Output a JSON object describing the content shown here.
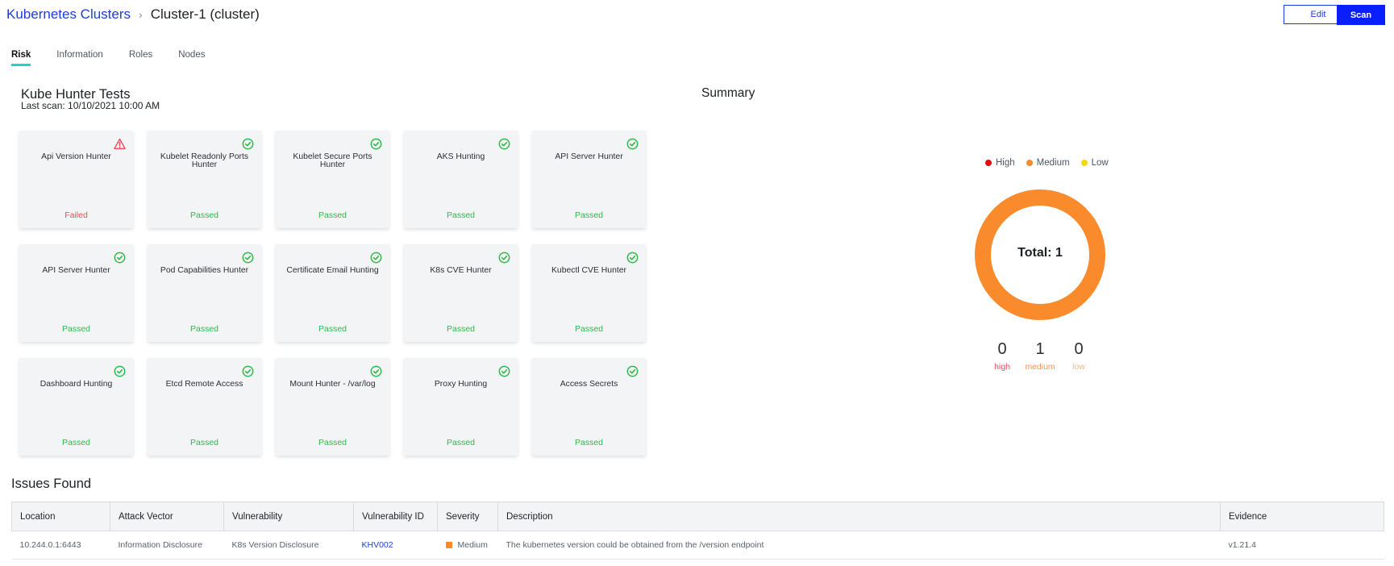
{
  "breadcrumb": {
    "parent": "Kubernetes Clusters",
    "separator": "›",
    "current": "Cluster-1 (cluster)"
  },
  "header_actions": {
    "edit_label": "Edit",
    "scan_label": "Scan"
  },
  "tabs": [
    {
      "label": "Risk",
      "active": true
    },
    {
      "label": "Information",
      "active": false
    },
    {
      "label": "Roles",
      "active": false
    },
    {
      "label": "Nodes",
      "active": false
    }
  ],
  "tests": {
    "title": "Kube Hunter Tests",
    "last_scan": "Last scan: 10/10/2021 10:00 AM",
    "items": [
      {
        "name": "Api Version Hunter",
        "status": "Failed",
        "icon": "warning-icon"
      },
      {
        "name": "Kubelet Readonly Ports Hunter",
        "status": "Passed",
        "icon": "check-circle-icon"
      },
      {
        "name": "Kubelet Secure Ports Hunter",
        "status": "Passed",
        "icon": "check-circle-icon"
      },
      {
        "name": "AKS Hunting",
        "status": "Passed",
        "icon": "check-circle-icon"
      },
      {
        "name": "API Server Hunter",
        "status": "Passed",
        "icon": "check-circle-icon"
      },
      {
        "name": "API Server Hunter",
        "status": "Passed",
        "icon": "check-circle-icon"
      },
      {
        "name": "Pod Capabilities Hunter",
        "status": "Passed",
        "icon": "check-circle-icon"
      },
      {
        "name": "Certificate Email Hunting",
        "status": "Passed",
        "icon": "check-circle-icon"
      },
      {
        "name": "K8s CVE Hunter",
        "status": "Passed",
        "icon": "check-circle-icon"
      },
      {
        "name": "Kubectl CVE Hunter",
        "status": "Passed",
        "icon": "check-circle-icon"
      },
      {
        "name": "Dashboard Hunting",
        "status": "Passed",
        "icon": "check-circle-icon"
      },
      {
        "name": "Etcd Remote Access",
        "status": "Passed",
        "icon": "check-circle-icon"
      },
      {
        "name": "Mount Hunter - /var/log",
        "status": "Passed",
        "icon": "check-circle-icon"
      },
      {
        "name": "Proxy Hunting",
        "status": "Passed",
        "icon": "check-circle-icon"
      },
      {
        "name": "Access Secrets",
        "status": "Passed",
        "icon": "check-circle-icon"
      }
    ]
  },
  "summary": {
    "title": "Summary",
    "legend": [
      {
        "label": "High",
        "color": "#e00f0f"
      },
      {
        "label": "Medium",
        "color": "#f98b2c"
      },
      {
        "label": "Low",
        "color": "#f5d800"
      }
    ],
    "total_label": "Total: 1",
    "counts": [
      {
        "value": "0",
        "label": "high",
        "color": "#ef4a5a"
      },
      {
        "value": "1",
        "label": "medium",
        "color": "#f5935a"
      },
      {
        "value": "0",
        "label": "low",
        "color": "#f7b98a"
      }
    ]
  },
  "issues": {
    "title": "Issues Found",
    "columns": [
      "Location",
      "Attack Vector",
      "Vulnerability",
      "Vulnerability ID",
      "Severity",
      "Description",
      "Evidence"
    ],
    "rows": [
      {
        "location": "10.244.0.1:6443",
        "attack_vector": "Information Disclosure",
        "vulnerability": "K8s Version Disclosure",
        "vulnerability_id": "KHV002",
        "severity": "Medium",
        "severity_color": "#f98b2c",
        "description": "The kubernetes version could be obtained from the /version endpoint",
        "evidence": "v1.21.4"
      }
    ]
  },
  "colors": {
    "accent": "#0a1fff",
    "passed": "#2fb94a",
    "failed": "#ef4a5a",
    "tab_underline": "#1ed6c5"
  }
}
